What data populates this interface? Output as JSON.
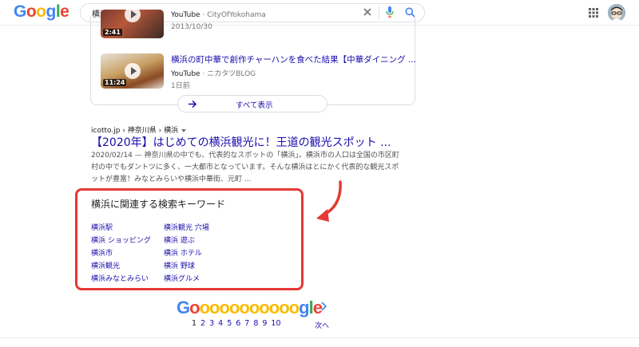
{
  "header": {
    "logo_letters": [
      "G",
      "o",
      "o",
      "g",
      "l",
      "e"
    ],
    "search_value": "横浜",
    "colors": {
      "blue": "#4285f4",
      "red": "#ea4335",
      "yellow": "#fbbc05",
      "green": "#34a853"
    }
  },
  "videos": [
    {
      "duration": "2:41",
      "source": "YouTube",
      "channel": "CityOfYokohama",
      "date": "2013/10/30"
    },
    {
      "duration": "11:24",
      "title": "横浜の町中華で創作チャーハンを食べた結果【中華ダイニング ...",
      "source": "YouTube",
      "channel": "ニカタツBLOG",
      "date": "1日前"
    }
  ],
  "video_separator": " · ",
  "show_all_label": "すべて表示",
  "result": {
    "breadcrumb": "icotto.jp › 神奈川県 › 横浜",
    "title": "【2020年】はじめての横浜観光に！王道の観光スポット ...",
    "snippet_line1": "2020/02/14 — 神奈川県の中でも、代表的なスポットの「横浜」。横浜市の人口は全国の市区町",
    "snippet_line2": "村の中でもダントツに多く、一大都市となっています。そんな横浜はとにかく代表的な観光スポ",
    "snippet_line3": "ットが豊富！みなとみらいや横浜中華街、元町 ..."
  },
  "related": {
    "title": "横浜に関連する検索キーワード",
    "left": [
      "横浜駅",
      "横浜 ショッピング",
      "横浜市",
      "横浜観光",
      "横浜みなとみらい"
    ],
    "right": [
      "横浜観光 穴場",
      "横浜 遊ぶ",
      "横浜 ホテル",
      "横浜 野球",
      "横浜グルメ"
    ]
  },
  "pagination": {
    "pages": [
      "1",
      "2",
      "3",
      "4",
      "5",
      "6",
      "7",
      "8",
      "9",
      "10"
    ],
    "current": "1",
    "next_label": "次へ"
  }
}
